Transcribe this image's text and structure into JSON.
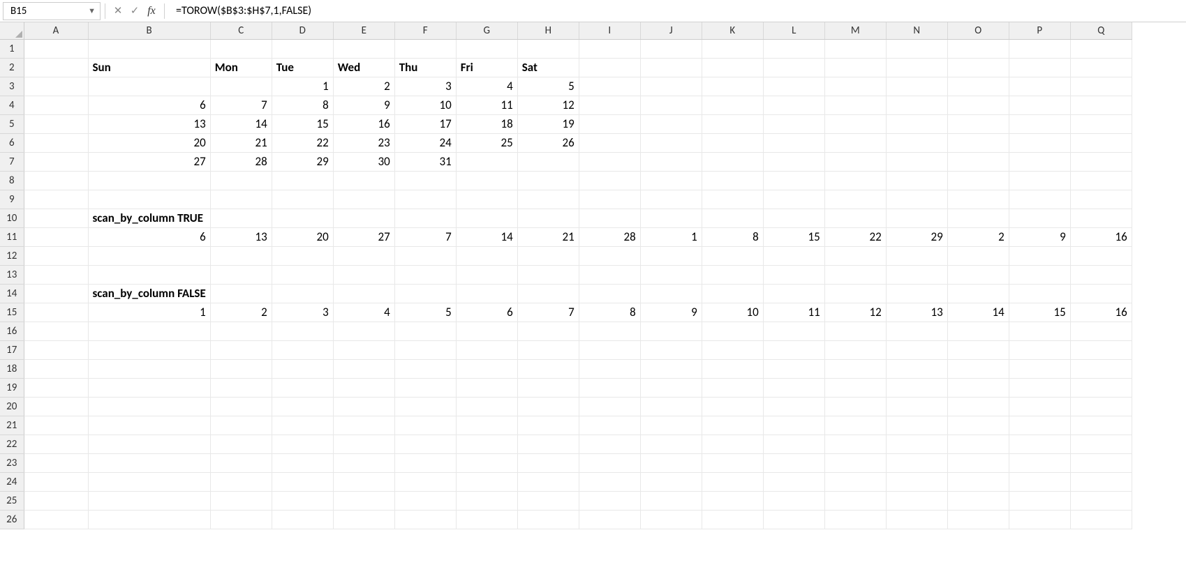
{
  "formula_bar": {
    "cell_ref": "B15",
    "formula": "=TOROW($B$3:$H$7,1,FALSE)"
  },
  "columns": [
    "A",
    "B",
    "C",
    "D",
    "E",
    "F",
    "G",
    "H",
    "I",
    "J",
    "K",
    "L",
    "M",
    "N",
    "O",
    "P",
    "Q"
  ],
  "row_count": 26,
  "cells": {
    "B2": {
      "v": "Sun",
      "bold": true
    },
    "C2": {
      "v": "Mon",
      "bold": true
    },
    "D2": {
      "v": "Tue",
      "bold": true
    },
    "E2": {
      "v": "Wed",
      "bold": true
    },
    "F2": {
      "v": "Thu",
      "bold": true
    },
    "G2": {
      "v": "Fri",
      "bold": true
    },
    "H2": {
      "v": "Sat",
      "bold": true
    },
    "D3": {
      "v": "1",
      "num": true
    },
    "E3": {
      "v": "2",
      "num": true
    },
    "F3": {
      "v": "3",
      "num": true
    },
    "G3": {
      "v": "4",
      "num": true
    },
    "H3": {
      "v": "5",
      "num": true
    },
    "B4": {
      "v": "6",
      "num": true
    },
    "C4": {
      "v": "7",
      "num": true
    },
    "D4": {
      "v": "8",
      "num": true
    },
    "E4": {
      "v": "9",
      "num": true
    },
    "F4": {
      "v": "10",
      "num": true
    },
    "G4": {
      "v": "11",
      "num": true
    },
    "H4": {
      "v": "12",
      "num": true
    },
    "B5": {
      "v": "13",
      "num": true
    },
    "C5": {
      "v": "14",
      "num": true
    },
    "D5": {
      "v": "15",
      "num": true
    },
    "E5": {
      "v": "16",
      "num": true
    },
    "F5": {
      "v": "17",
      "num": true
    },
    "G5": {
      "v": "18",
      "num": true
    },
    "H5": {
      "v": "19",
      "num": true
    },
    "B6": {
      "v": "20",
      "num": true
    },
    "C6": {
      "v": "21",
      "num": true
    },
    "D6": {
      "v": "22",
      "num": true
    },
    "E6": {
      "v": "23",
      "num": true
    },
    "F6": {
      "v": "24",
      "num": true
    },
    "G6": {
      "v": "25",
      "num": true
    },
    "H6": {
      "v": "26",
      "num": true
    },
    "B7": {
      "v": "27",
      "num": true
    },
    "C7": {
      "v": "28",
      "num": true
    },
    "D7": {
      "v": "29",
      "num": true
    },
    "E7": {
      "v": "30",
      "num": true
    },
    "F7": {
      "v": "31",
      "num": true
    },
    "B10": {
      "v": "scan_by_column TRUE",
      "bold": true,
      "overflow": true
    },
    "B11": {
      "v": "6",
      "num": true
    },
    "C11": {
      "v": "13",
      "num": true
    },
    "D11": {
      "v": "20",
      "num": true
    },
    "E11": {
      "v": "27",
      "num": true
    },
    "F11": {
      "v": "7",
      "num": true
    },
    "G11": {
      "v": "14",
      "num": true
    },
    "H11": {
      "v": "21",
      "num": true
    },
    "I11": {
      "v": "28",
      "num": true
    },
    "J11": {
      "v": "1",
      "num": true
    },
    "K11": {
      "v": "8",
      "num": true
    },
    "L11": {
      "v": "15",
      "num": true
    },
    "M11": {
      "v": "22",
      "num": true
    },
    "N11": {
      "v": "29",
      "num": true
    },
    "O11": {
      "v": "2",
      "num": true
    },
    "P11": {
      "v": "9",
      "num": true
    },
    "Q11": {
      "v": "16",
      "num": true
    },
    "B14": {
      "v": "scan_by_column FALSE",
      "bold": true,
      "overflow": true
    },
    "B15": {
      "v": "1",
      "num": true
    },
    "C15": {
      "v": "2",
      "num": true
    },
    "D15": {
      "v": "3",
      "num": true
    },
    "E15": {
      "v": "4",
      "num": true
    },
    "F15": {
      "v": "5",
      "num": true
    },
    "G15": {
      "v": "6",
      "num": true
    },
    "H15": {
      "v": "7",
      "num": true
    },
    "I15": {
      "v": "8",
      "num": true
    },
    "J15": {
      "v": "9",
      "num": true
    },
    "K15": {
      "v": "10",
      "num": true
    },
    "L15": {
      "v": "11",
      "num": true
    },
    "M15": {
      "v": "12",
      "num": true
    },
    "N15": {
      "v": "13",
      "num": true
    },
    "O15": {
      "v": "14",
      "num": true
    },
    "P15": {
      "v": "15",
      "num": true
    },
    "Q15": {
      "v": "16",
      "num": true
    }
  }
}
